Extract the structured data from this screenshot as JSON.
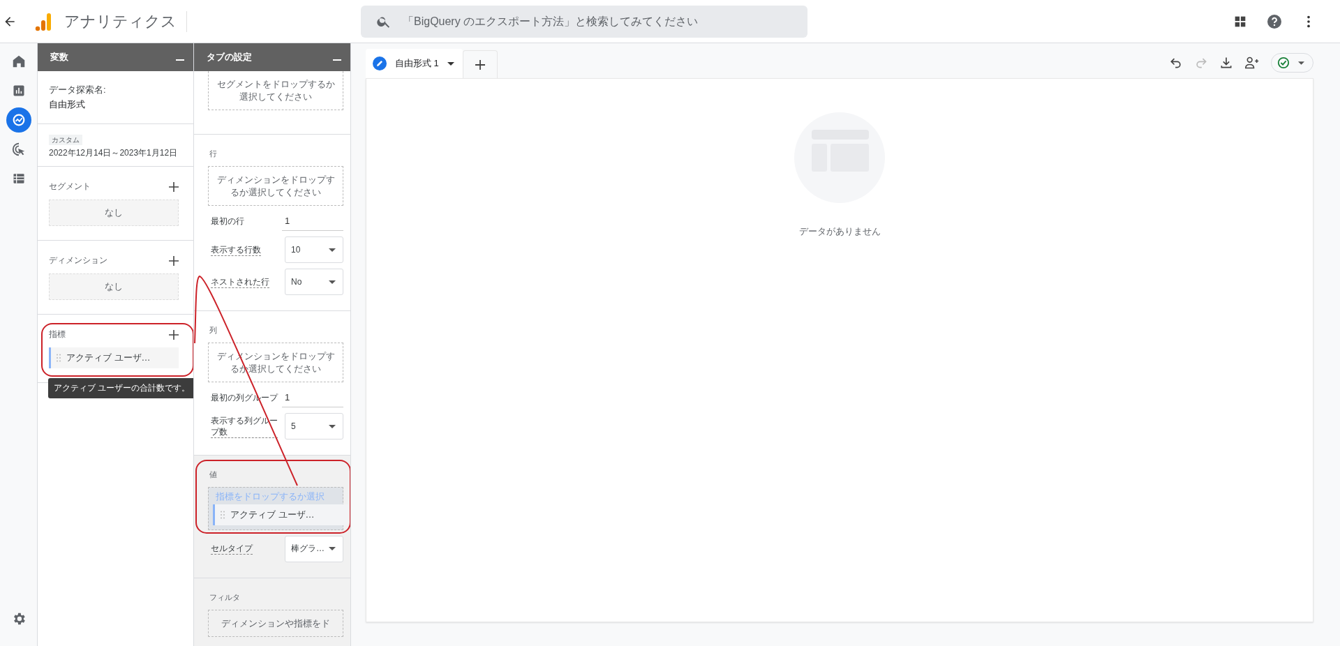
{
  "app": {
    "title": "アナリティクス"
  },
  "search": {
    "placeholder": "「BigQuery のエクスポート方法」と検索してみてください"
  },
  "nav_rail": {
    "items": [
      {
        "kind": "home",
        "selected": false
      },
      {
        "kind": "reports",
        "selected": false
      },
      {
        "kind": "explore",
        "selected": true
      },
      {
        "kind": "advertising",
        "selected": false
      },
      {
        "kind": "list",
        "selected": false
      }
    ]
  },
  "variables_panel": {
    "title": "変数",
    "exploration_name_label": "データ探索名:",
    "exploration_name": "自由形式",
    "date_badge": "カスタム",
    "date_range": "2022年12月14日～2023年1月12日",
    "sections": [
      {
        "label": "セグメント",
        "empty_text": "なし"
      },
      {
        "label": "ディメンション",
        "empty_text": "なし"
      },
      {
        "label": "指標",
        "annotated": true,
        "chips": [
          "アクティブ ユーザ…"
        ],
        "tooltip": "アクティブ ユーザーの合計数です。"
      }
    ]
  },
  "tab_settings": {
    "title": "タブの設定",
    "sections": [
      {
        "highlighted": false,
        "items": [
          {
            "kind": "dropzone",
            "text": "セグメントをドロップするか選択してください"
          }
        ]
      },
      {
        "label": "行",
        "highlighted": false,
        "items": [
          {
            "kind": "dropzone",
            "text": "ディメンションをドロップするか選択してください"
          },
          {
            "kind": "number",
            "label": "最初の行",
            "value": "1"
          },
          {
            "kind": "select",
            "label": "表示する行数",
            "value": "10"
          },
          {
            "kind": "select",
            "label": "ネストされた行",
            "value": "No"
          }
        ]
      },
      {
        "label": "列",
        "highlighted": false,
        "items": [
          {
            "kind": "dropzone",
            "text": "ディメンションをドロップするか選択してください"
          },
          {
            "kind": "number",
            "label": "最初の列グループ",
            "value": "1"
          },
          {
            "kind": "select",
            "label": "表示する列グループ数",
            "value": "5"
          }
        ]
      },
      {
        "label": "値",
        "highlighted": true,
        "annotated": true,
        "items": [
          {
            "kind": "dropzone",
            "text": "指標をドロップするか選択",
            "dragged_chip": "アクティブ ユーザ…"
          },
          {
            "kind": "select",
            "label": "セルタイプ",
            "value": "棒グラ…"
          }
        ]
      },
      {
        "label": "フィルタ",
        "highlighted": true,
        "items": [
          {
            "kind": "dropzone",
            "text": "ディメンションや指標をド"
          }
        ]
      }
    ]
  },
  "editor": {
    "tabs": [
      {
        "label": "自由形式 1",
        "selected": true
      }
    ],
    "toolbar": [
      {
        "kind": "undo",
        "disabled": false
      },
      {
        "kind": "redo",
        "disabled": true
      },
      {
        "kind": "download",
        "disabled": false
      },
      {
        "kind": "share",
        "disabled": false
      }
    ],
    "empty_text": "データがありません"
  }
}
